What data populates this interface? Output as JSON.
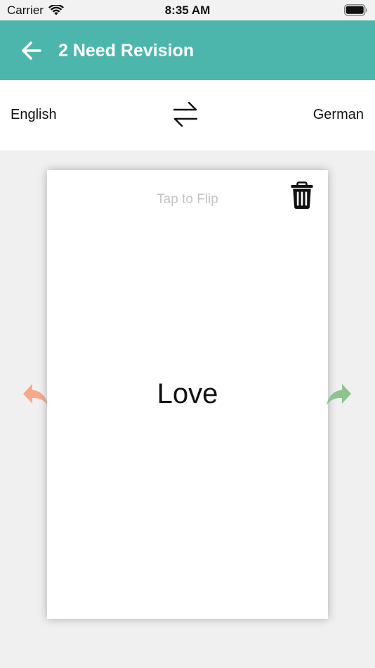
{
  "status_bar": {
    "carrier": "Carrier",
    "time": "8:35 AM",
    "icons": [
      "wifi-icon",
      "battery-icon"
    ]
  },
  "nav": {
    "back_icon": "arrow-left-icon",
    "title": "2 Need Revision",
    "background_color": "#4db6ac"
  },
  "languages": {
    "source": "English",
    "target": "German",
    "swap_icon": "swap-arrows-icon"
  },
  "card": {
    "hint": "Tap to Flip",
    "word": "Love",
    "delete_icon": "trash-icon"
  },
  "navigation_arrows": {
    "previous_icon": "reply-left-icon",
    "previous_color": "#f5a98a",
    "next_icon": "forward-right-icon",
    "next_color": "#8bc48f"
  }
}
